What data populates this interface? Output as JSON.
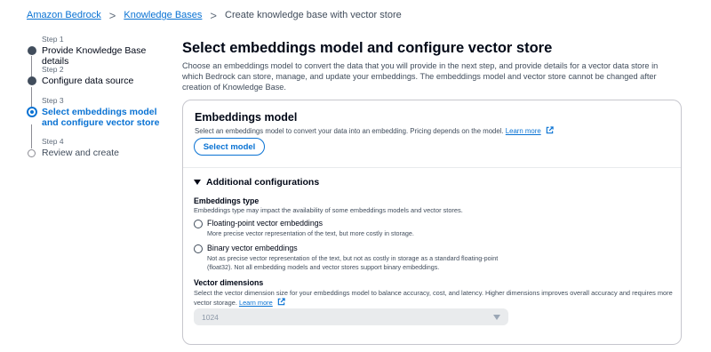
{
  "breadcrumb": {
    "items": [
      "Amazon Bedrock",
      "Knowledge Bases"
    ],
    "current": "Create knowledge base with vector store",
    "separator": ">"
  },
  "steps": [
    {
      "number": "Step 1",
      "label": "Provide Knowledge Base details",
      "state": "done"
    },
    {
      "number": "Step 2",
      "label": "Configure data source",
      "state": "done"
    },
    {
      "number": "Step 3",
      "label": "Select embeddings model and configure vector store",
      "state": "active"
    },
    {
      "number": "Step 4",
      "label": "Review and create",
      "state": "pending"
    }
  ],
  "main": {
    "title": "Select embeddings model and configure vector store",
    "description": "Choose an embeddings model to convert the data that you will provide in the next step, and provide details for a vector data store in which Bedrock can store, manage, and update your embeddings. The embeddings model and vector store cannot be changed after creation of Knowledge Base."
  },
  "embeddings": {
    "heading": "Embeddings model",
    "description": "Select an embeddings model to convert your data into an embedding. Pricing depends on the model.",
    "learn_more": "Learn more",
    "button": "Select model"
  },
  "additional": {
    "label": "Additional configurations",
    "embeddings_type": {
      "label": "Embeddings type",
      "description": "Embeddings type may impact the availability of some embeddings models and vector stores.",
      "options": [
        {
          "label": "Floating-point vector embeddings",
          "description": "More precise vector representation of the text, but more costly in storage."
        },
        {
          "label": "Binary vector embeddings",
          "description": "Not as precise vector representation of the text, but not as costly in storage as a standard floating-point (float32). Not all embedding models and vector stores support binary embeddings."
        }
      ]
    },
    "vector_dimensions": {
      "label": "Vector dimensions",
      "description": "Select the vector dimension size for your embeddings model to balance accuracy, cost, and latency. Higher dimensions improves overall accuracy and requires more vector storage.",
      "learn_more": "Learn more",
      "value": "1024"
    }
  },
  "colors": {
    "link": "#0972d3",
    "text": "#000716",
    "muted": "#414d5c",
    "border": "#c6c6cd"
  }
}
